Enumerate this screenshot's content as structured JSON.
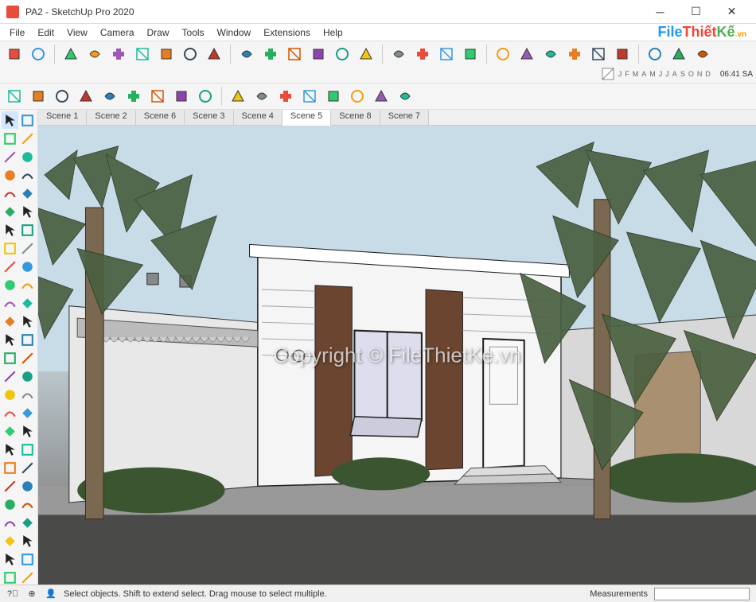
{
  "titlebar": {
    "title": "PA2 - SketchUp Pro 2020"
  },
  "menu": {
    "items": [
      "File",
      "Edit",
      "View",
      "Camera",
      "Draw",
      "Tools",
      "Window",
      "Extensions",
      "Help"
    ]
  },
  "logo": {
    "text1": "File",
    "text2": "Thiết",
    "text3": "Kế",
    "suffix": ".vn"
  },
  "time": "06:41 SA",
  "months": [
    "J",
    "F",
    "M",
    "A",
    "M",
    "J",
    "J",
    "A",
    "S",
    "O",
    "N",
    "D"
  ],
  "tabs": {
    "items": [
      {
        "label": "Scene 1",
        "active": false
      },
      {
        "label": "Scene 2",
        "active": false
      },
      {
        "label": "Scene 6",
        "active": false
      },
      {
        "label": "Scene 3",
        "active": false
      },
      {
        "label": "Scene 4",
        "active": false
      },
      {
        "label": "Scene 5",
        "active": true
      },
      {
        "label": "Scene 8",
        "active": false
      },
      {
        "label": "Scene 7",
        "active": false
      }
    ]
  },
  "watermark": "Copyright © FileThietKe.vn",
  "statusbar": {
    "hint": "Select objects. Shift to extend select. Drag mouse to select multiple.",
    "measurements_label": "Measurements"
  },
  "toolbar_icons": {
    "row1": [
      "select-layer",
      "component",
      "iso",
      "front",
      "back",
      "top",
      "left",
      "right",
      "camera-orbit",
      "wireframe",
      "hidden",
      "shaded",
      "textured",
      "monochrome",
      "xray",
      "section-plane",
      "section-cut",
      "section-fill",
      "render",
      "vray",
      "light",
      "teapot",
      "cloud",
      "settings",
      "frame",
      "anim",
      "lock",
      "unlock"
    ],
    "row2": [
      "solar",
      "shadow",
      "circle",
      "arc",
      "sun",
      "flash",
      "shadow2",
      "oval",
      "dome",
      "box",
      "cube1",
      "cube2",
      "cube3",
      "cube4",
      "cube5",
      "push",
      "follow"
    ]
  },
  "left_tools": [
    [
      "select",
      "rectangle-select"
    ],
    [
      "line",
      "freehand"
    ],
    [
      "pencil",
      "arc"
    ],
    [
      "eraser",
      "tape"
    ],
    [
      "rectangle",
      "circle"
    ],
    [
      "pie",
      "polygon"
    ],
    [
      "arc2",
      "arc3"
    ],
    [
      "pushpull",
      "offset"
    ],
    [
      "move",
      "rotate"
    ],
    [
      "followme",
      "scale"
    ],
    [
      "offset2",
      "tape2"
    ],
    [
      "protractor",
      "text"
    ],
    [
      "dimension",
      "label"
    ],
    [
      "axes",
      "3dtext"
    ],
    [
      "paint",
      "sample"
    ],
    [
      "section",
      "walk"
    ],
    [
      "orbit",
      "pan"
    ],
    [
      "zoom",
      "zoomwin"
    ],
    [
      "zoomext",
      "previous"
    ],
    [
      "position",
      "look"
    ],
    [
      "walk2",
      "sandbox"
    ],
    [
      "stamp",
      "drape"
    ],
    [
      "smoove",
      "addDetail"
    ],
    [
      "flip",
      "contour"
    ],
    [
      "solid1",
      "solid2"
    ],
    [
      "outer",
      "trim"
    ]
  ]
}
